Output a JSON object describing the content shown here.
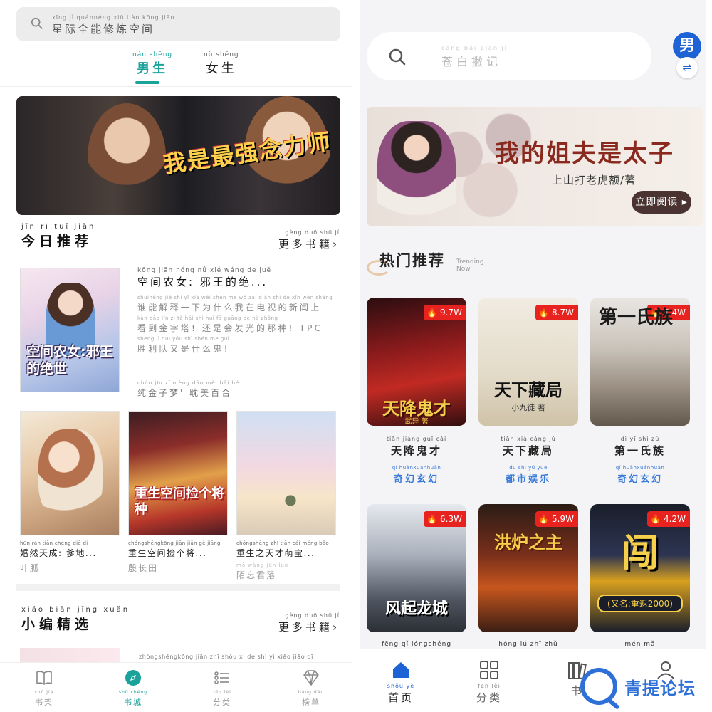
{
  "left": {
    "search": {
      "pinyin": "xīng  jì  quánnéng xiū  liàn kōng jiān",
      "text": "星际全能修炼空间"
    },
    "tabs": [
      {
        "pinyin": "nán shēng",
        "label": "男生",
        "active": true
      },
      {
        "pinyin": "nǚ shēng",
        "label": "女生",
        "active": false
      }
    ],
    "banner": {
      "title": "我是最强念力师"
    },
    "today": {
      "pinyin": "jīn  rì  tuī  jiàn",
      "title": "今日推荐",
      "more_pinyin": "gèng duō shū  jí",
      "more": "更多书籍›"
    },
    "featured": {
      "cover_text": "空间农女:邪王的绝世",
      "title_pinyin": "kōng jiān nóng  nǚ       xié wáng de  jué",
      "title": "空间农女: 邪王的绝...",
      "desc": [
        {
          "py": "shuínéng jiě   shì  yī  xià wèi shén me  wǒ  zài diàn shì  de  xīn wén shàng",
          "hz": "谁能解释一下为什么我在电视的新闻上"
        },
        {
          "py": "kàn dào jīn  zì   tǎ      hái  shì huì fā guāng de  nà zhǒng",
          "hz": "看到金字塔! 还是会发光的那种! TPC"
        },
        {
          "py": "shèng lì  duì  yǒu shì shén me  guǐ",
          "hz": "胜利队又是什么鬼!"
        }
      ],
      "author_pinyin": "chún jīn  zǐ  mèng     dān měi  bǎi  hé",
      "author": "纯金子梦' 耽美百合"
    },
    "grid": [
      {
        "title_pinyin": "hūn rán tiān chéng       diē   di",
        "title": "婚然天成: 爹地...",
        "author_pinyin": "",
        "author": "叶胍"
      },
      {
        "title_pinyin": "chóngshēngkōng jiān jiǎn  gè  jiāng",
        "title": "重生空间捡个将...",
        "author_pinyin": "",
        "author": "殷长田",
        "cover_text": "重生空间捡个将种"
      },
      {
        "title_pinyin": "chóngshēng zhī  tiān cái méng bǎo",
        "title": "重生之天才萌宝...",
        "author_pinyin": "mò wàng jūn  luò",
        "author": "陌忘君落"
      }
    ],
    "editor": {
      "pinyin": "xiǎo biān  jīng  xuǎn",
      "title": "小编精选",
      "more_pinyin": "gèng duō shū  jí",
      "more": "更多书籍›"
    },
    "peek_text": "zhòngshēngkōng jiān  zhī  shǒu  xì    de   shì   yì   xiǎo  jiāo   qī",
    "nav": [
      {
        "pinyin": "shū  jià",
        "label": "书架",
        "icon": "book-icon",
        "active": false
      },
      {
        "pinyin": "shū chéng",
        "label": "书城",
        "icon": "compass-icon",
        "active": true
      },
      {
        "pinyin": "fēn   lèi",
        "label": "分类",
        "icon": "category-icon",
        "active": false
      },
      {
        "pinyin": "bǎng dān",
        "label": "榜单",
        "icon": "diamond-icon",
        "active": false
      }
    ]
  },
  "right": {
    "search": {
      "pinyin": "cāng bái  piān   jì",
      "placeholder": "苍白撇记"
    },
    "gender_badge": "男",
    "swap_icon": "⇌",
    "banner": {
      "title": "我的姐夫是太子",
      "author": "上山打老虎额/著",
      "button": "立即阅读 ▸"
    },
    "hot": {
      "title": "热门推荐",
      "en1": "Trending",
      "en2": "Now"
    },
    "books": [
      {
        "heat": "9.7W",
        "cover_title": "天降鬼才",
        "cover_sub": "武异 著",
        "title_pinyin": "tiān jiàng  guǐ   cái",
        "title": "天降鬼才",
        "cat_pinyin": "qí  huànxuánhuàn",
        "cat": "奇幻玄幻"
      },
      {
        "heat": "8.7W",
        "cover_title": "天下藏局",
        "cover_sub": "小九徒 著",
        "title_pinyin": "tiān  xià  cáng   jú",
        "title": "天下藏局",
        "cat_pinyin": "dū  shì  yú  yuè",
        "cat": "都市娱乐"
      },
      {
        "heat": "7.4W",
        "cover_title": "第一氏族",
        "cover_sub": "",
        "title_pinyin": "dì    yī   shì   zú",
        "title": "第一氏族",
        "cat_pinyin": "qí  huànxuánhuàn",
        "cat": "奇幻玄幻"
      },
      {
        "heat": "6.3W",
        "cover_title": "风起龙城",
        "cover_sub": "",
        "title_pinyin": "fēng  qǐ  lóngchéng",
        "title": "",
        "cat_pinyin": "",
        "cat": ""
      },
      {
        "heat": "5.9W",
        "cover_title": "洪炉之主",
        "cover_sub": "",
        "title_pinyin": "hóng  lú   zhī  zhǔ",
        "title": "",
        "cat_pinyin": "",
        "cat": ""
      },
      {
        "heat": "4.2W",
        "cover_title": "闯",
        "cover_sub": "(又名:重返2000)",
        "title_pinyin": "mén  mǎ",
        "title": "",
        "cat_pinyin": "",
        "cat": ""
      }
    ],
    "nav": [
      {
        "pinyin": "shǒu  yè",
        "label": "首页",
        "icon": "home-icon",
        "active": true
      },
      {
        "pinyin": "fēn   lèi",
        "label": "分类",
        "icon": "grid-icon",
        "active": false
      },
      {
        "pinyin": "",
        "label": "书",
        "icon": "bookshelf-icon",
        "active": false
      },
      {
        "pinyin": "",
        "label": "",
        "icon": "user-icon",
        "active": false
      }
    ],
    "watermark": "青提论坛"
  }
}
